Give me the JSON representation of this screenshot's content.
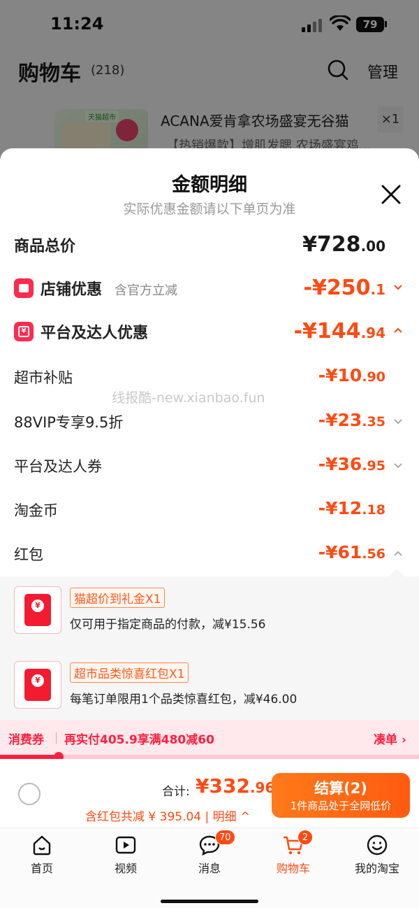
{
  "status_bar": {
    "time": "11:24",
    "battery": "79"
  },
  "cart": {
    "title": "购物车",
    "count": "(218)",
    "manage": "管理",
    "product": {
      "store_tag": "天猫超市",
      "name": "ACANA爱肯拿农场盛宴无谷猫",
      "subtitle": "【热销爆款】增肌发腮 农场盛宴鸡…",
      "qty": "×1"
    }
  },
  "sheet": {
    "title": "金额明细",
    "subtitle": "实际优惠金额请以下单页为准",
    "watermark": "线报酷-new.xianbao.fun",
    "total": {
      "label": "商品总价",
      "big": "¥728",
      "small": ".00"
    },
    "store_discount": {
      "label": "店铺优惠",
      "note": "含官方立减",
      "big": "-¥250",
      "small": ".1"
    },
    "platform_discount": {
      "label": "平台及达人优惠",
      "big": "-¥144",
      "small": ".94"
    },
    "items": [
      {
        "label": "超市补贴",
        "big": "-¥10",
        "small": ".90",
        "chevron": "none"
      },
      {
        "label": "88VIP专享9.5折",
        "big": "-¥23",
        "small": ".35",
        "chevron": "down"
      },
      {
        "label": "平台及达人券",
        "big": "-¥36",
        "small": ".95",
        "chevron": "down"
      },
      {
        "label": "淘金币",
        "big": "-¥12",
        "small": ".18",
        "chevron": "none"
      },
      {
        "label": "红包",
        "big": "-¥61",
        "small": ".56",
        "chevron": "up"
      }
    ],
    "coupons": [
      {
        "tag": "猫超价到礼金X1",
        "desc": "仅可用于指定商品的付款，减¥15.56",
        "seal": "¥"
      },
      {
        "tag": "超市品类惊喜红包X1",
        "desc": "每笔订单限用1个品类惊喜红包，减¥46.00",
        "seal": "¥"
      }
    ]
  },
  "promo": {
    "label": "消费券",
    "text": "再实付405.9享满480减60",
    "link": "凑单 ›",
    "progress": 0.14
  },
  "checkout": {
    "total_label": "合计:",
    "total_big": "¥332",
    "total_small": ".96",
    "saved": "含红包共减 ¥ 395.04 | 明细 ^",
    "pay_label": "结算(2)",
    "pay_sub": "1件商品处于全网低价"
  },
  "tabbar": [
    {
      "label": "首页",
      "icon": "home-icon",
      "badge": ""
    },
    {
      "label": "视频",
      "icon": "video-icon",
      "badge": ""
    },
    {
      "label": "消息",
      "icon": "message-icon",
      "badge": "70"
    },
    {
      "label": "购物车",
      "icon": "cart-icon",
      "badge": "2"
    },
    {
      "label": "我的淘宝",
      "icon": "profile-icon",
      "badge": ""
    }
  ],
  "colors": {
    "accent": "#ff4a12",
    "promo_red": "#ff2040",
    "envelope": "#f21b30"
  }
}
